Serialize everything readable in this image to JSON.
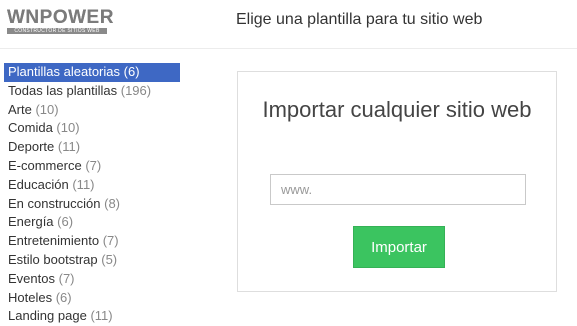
{
  "logo": {
    "main": "WNPOWER",
    "tagline": "CONSTRUCTOR DE SITIOS WEB"
  },
  "header": {
    "title": "Elige una plantilla para tu sitio web"
  },
  "sidebar": {
    "items": [
      {
        "label": "Plantillas aleatorias",
        "count": "(6)",
        "active": true
      },
      {
        "label": "Todas las plantillas",
        "count": "(196)"
      },
      {
        "label": "Arte",
        "count": "(10)"
      },
      {
        "label": "Comida",
        "count": "(10)"
      },
      {
        "label": "Deporte",
        "count": "(11)"
      },
      {
        "label": "E-commerce",
        "count": "(7)"
      },
      {
        "label": "Educación",
        "count": "(11)"
      },
      {
        "label": "En construcción",
        "count": "(8)"
      },
      {
        "label": "Energía",
        "count": "(6)"
      },
      {
        "label": "Entretenimiento",
        "count": "(7)"
      },
      {
        "label": "Estilo bootstrap",
        "count": "(5)"
      },
      {
        "label": "Eventos",
        "count": "(7)"
      },
      {
        "label": "Hoteles",
        "count": "(6)"
      },
      {
        "label": "Landing page",
        "count": "(11)"
      }
    ]
  },
  "import_panel": {
    "title": "Importar cualquier sitio web",
    "input_placeholder": "www.",
    "input_value": "",
    "button_label": "Importar"
  },
  "colors": {
    "active_bg": "#3e68c4",
    "button_green": "#3bc460"
  }
}
